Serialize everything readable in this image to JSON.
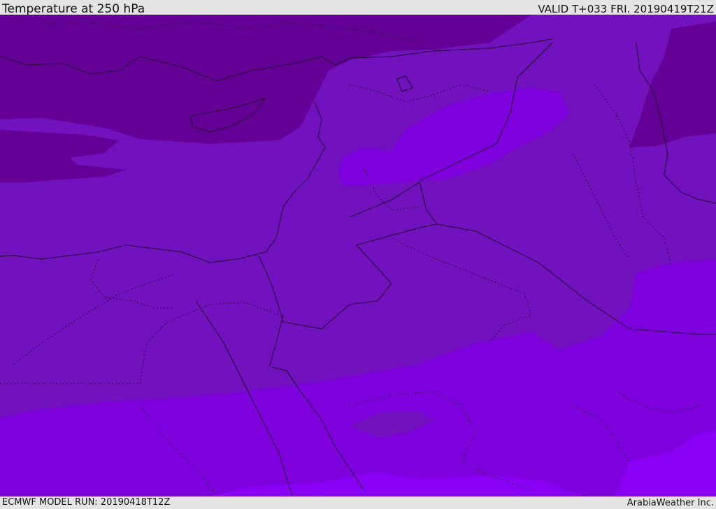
{
  "header": {
    "title": "Temperature at 250 hPa",
    "valid": "VALID T+033 FRI. 20190419T21Z"
  },
  "footer": {
    "model_run": "ECMWF MODEL RUN: 20190418T12Z",
    "credit": "ArabiaWeather Inc."
  },
  "map": {
    "field": "temperature",
    "level_hpa": 250,
    "colors": {
      "darkest": "#640095",
      "dark": "#7013b0",
      "mid": "#7211be",
      "bright": "#7d00dd",
      "brightest": "#8a00f5",
      "border": "#1a0026"
    }
  }
}
